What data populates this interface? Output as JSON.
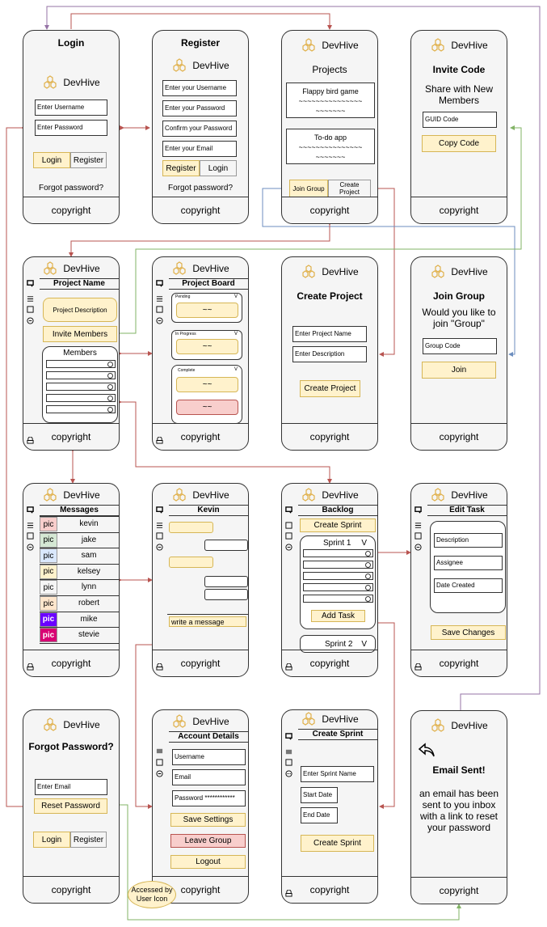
{
  "brand": "DevHive",
  "copyright": "copyright",
  "colors": {
    "yellow_fill": "#fff2cc",
    "yellow_border": "#d6b656",
    "red_fill": "#f8cecc",
    "arrow_red": "#b85450",
    "arrow_blue": "#6c8ebf",
    "arrow_green": "#82b366",
    "arrow_purple": "#9673a6"
  },
  "login": {
    "title": "Login",
    "username": "Enter Username",
    "password": "Enter Password",
    "login_btn": "Login",
    "register_btn": "Register",
    "forgot": "Forgot password?"
  },
  "register": {
    "title": "Register",
    "username": "Enter your Username",
    "password": "Enter your Password",
    "confirm": "Confirm your Password",
    "email": "Enter your Email",
    "register_btn": "Register",
    "login_btn": "Login",
    "forgot": "Forgot password?"
  },
  "projects": {
    "title": "Projects",
    "items": [
      {
        "name": "Flappy bird game",
        "tilde1": "~~~~~~~~~~~~~~~",
        "tilde2": "~~~~~~~"
      },
      {
        "name": "To-do app",
        "tilde1": "~~~~~~~~~~~~~~~",
        "tilde2": "~~~~~~~"
      }
    ],
    "join_btn": "Join Group",
    "create_btn": "Create Project"
  },
  "invite": {
    "title": "Invite Code",
    "subtitle": "Share with New Members",
    "field": "GUID Code",
    "copy_btn": "Copy Code"
  },
  "project_name": {
    "header": "Project Name",
    "description": "Project Description",
    "invite_btn": "Invite Members",
    "members_label": "Members"
  },
  "project_board": {
    "header": "Project Board",
    "columns": [
      {
        "label": "Pending",
        "chev": "V",
        "cards": [
          "~~"
        ]
      },
      {
        "label": "In Progress",
        "chev": "V",
        "cards": [
          "~~"
        ]
      },
      {
        "label": "Complete",
        "chev": "V",
        "cards": [
          "~~",
          "~~"
        ]
      }
    ]
  },
  "create_project": {
    "title": "Create Project",
    "name_field": "Enter Project Name",
    "desc_field": "Enter Description",
    "btn": "Create Project"
  },
  "join_group": {
    "title": "Join Group",
    "subtitle": "Would you like to join \"Group\"",
    "field": "Group Code",
    "btn": "Join"
  },
  "messages": {
    "header": "Messages",
    "pic": "pic",
    "contacts": [
      {
        "name": "kevin",
        "color": "#f8cecc"
      },
      {
        "name": "jake",
        "color": "#d5e8d4"
      },
      {
        "name": "sam",
        "color": "#dae8fc"
      },
      {
        "name": "kelsey",
        "color": "#fff2cc"
      },
      {
        "name": "lynn",
        "color": "#f5f5f5"
      },
      {
        "name": "robert",
        "color": "#ffe6cc"
      },
      {
        "name": "mike",
        "color": "#6a00ff"
      },
      {
        "name": "stevie",
        "color": "#d80073"
      }
    ]
  },
  "chat": {
    "header": "Kevin",
    "placeholder": "write a message"
  },
  "backlog": {
    "header": "Backlog",
    "create_btn": "Create Sprint",
    "sprint1": "Sprint 1",
    "sprint2": "Sprint 2",
    "chev": "V",
    "add_task": "Add Task"
  },
  "edit_task": {
    "header": "Edit Task",
    "description": "Description",
    "assignee": "Assignee",
    "date": "Date Created",
    "save_btn": "Save Changes"
  },
  "forgot": {
    "title": "Forgot Password?",
    "email": "Enter Email",
    "reset_btn": "Reset Password",
    "login_btn": "Login",
    "register_btn": "Register"
  },
  "account": {
    "header": "Account Details",
    "username": "Username",
    "email": "Email",
    "password": "Password ************",
    "settings_btn": "Save Settings",
    "leave_btn": "Leave Group",
    "logout_btn": "Logout"
  },
  "create_sprint": {
    "header": "Create Sprint",
    "name": "Enter Sprint Name",
    "start": "Start Date",
    "end": "End Date",
    "btn": "Create Sprint"
  },
  "email_sent": {
    "title": "Email Sent!",
    "body": "an email has been sent to you inbox with a link to reset your password"
  },
  "note": {
    "text": "Accessed by User Icon"
  }
}
